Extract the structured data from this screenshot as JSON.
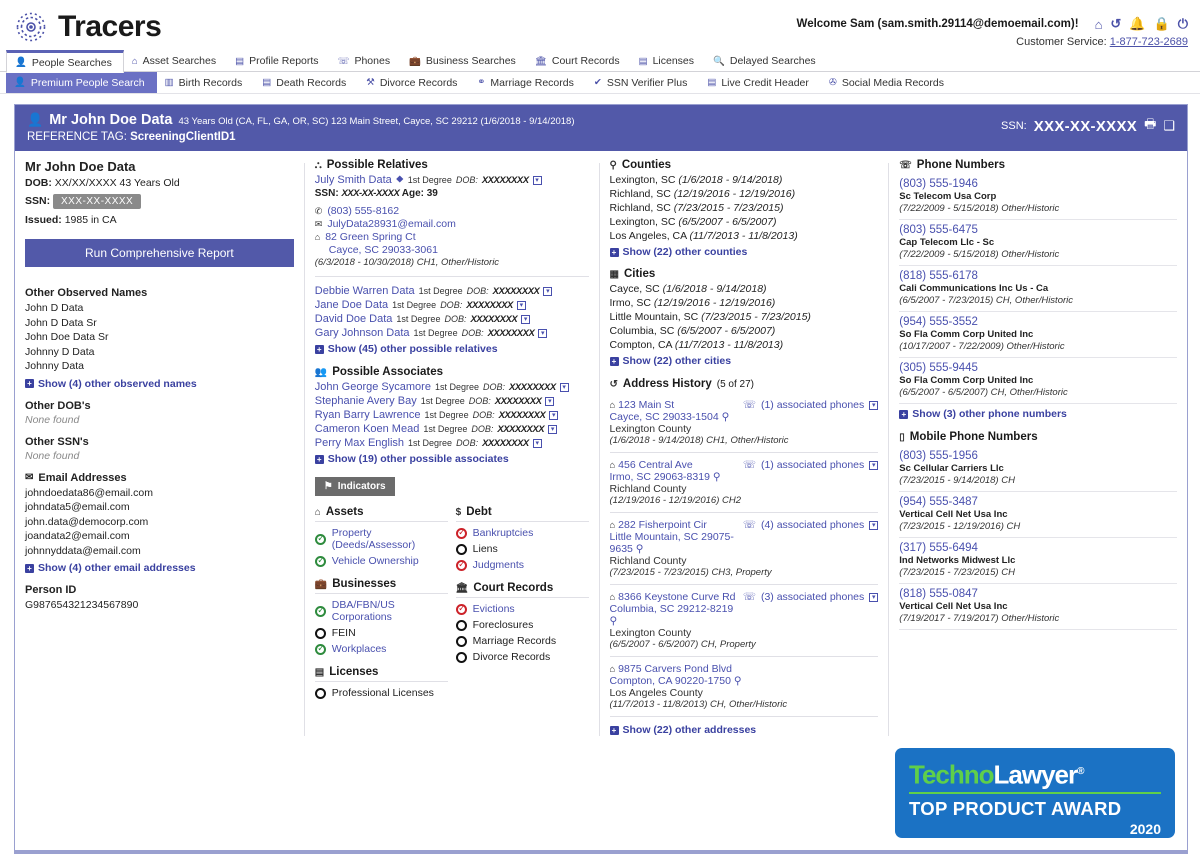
{
  "brand": {
    "name": "Tracers",
    "logo_icon": "radar-logo-icon"
  },
  "account": {
    "welcome": "Welcome Sam (sam.smith.29114@demoemail.com)!",
    "icons": [
      "home-icon",
      "history-icon",
      "bell-icon",
      "lock-icon",
      "power-icon"
    ],
    "customer_service_label": "Customer Service:",
    "customer_service_phone": "1-877-723-2689"
  },
  "nav_primary": [
    {
      "label": "People Searches",
      "icon": "person-icon",
      "active": true
    },
    {
      "label": "Asset Searches",
      "icon": "house-icon",
      "active": false
    },
    {
      "label": "Profile Reports",
      "icon": "document-icon",
      "active": false
    },
    {
      "label": "Phones",
      "icon": "phone-icon",
      "active": false
    },
    {
      "label": "Business Searches",
      "icon": "briefcase-icon",
      "active": false
    },
    {
      "label": "Court Records",
      "icon": "courthouse-icon",
      "active": false
    },
    {
      "label": "Licenses",
      "icon": "id-card-icon",
      "active": false
    },
    {
      "label": "Delayed Searches",
      "icon": "search-icon",
      "active": false
    }
  ],
  "nav_secondary": [
    {
      "label": "Premium People Search",
      "icon": "person-icon",
      "active": true
    },
    {
      "label": "Birth Records",
      "icon": "birth-icon",
      "active": false
    },
    {
      "label": "Death Records",
      "icon": "document-icon",
      "active": false
    },
    {
      "label": "Divorce Records",
      "icon": "broken-heart-icon",
      "active": false
    },
    {
      "label": "Marriage Records",
      "icon": "rings-icon",
      "active": false
    },
    {
      "label": "SSN Verifier Plus",
      "icon": "check-icon",
      "active": false
    },
    {
      "label": "Live Credit Header",
      "icon": "credit-card-icon",
      "active": false
    },
    {
      "label": "Social Media Records",
      "icon": "social-icon",
      "active": false
    }
  ],
  "banner": {
    "person_icon": "person-icon",
    "name": "Mr John Doe Data",
    "summary": "43 Years Old (CA, FL, GA, OR, SC) 123 Main Street, Cayce, SC 29212 (1/6/2018 - 9/14/2018)",
    "reference_tag_label": "REFERENCE TAG:",
    "reference_tag_value": "ScreeningClientID1",
    "ssn_label": "SSN:",
    "ssn_value": "XXX-XX-XXXX",
    "print_icon": "printer-icon",
    "save_icon": "save-icon",
    "bg_color": "#5259a9"
  },
  "identity": {
    "name": "Mr John Doe Data",
    "dob_label": "DOB:",
    "dob_value": "XX/XX/XXXX 43 Years Old",
    "ssn_label": "SSN:",
    "ssn_value": "XXX-XX-XXXX",
    "issued_label": "Issued:",
    "issued_value": "1985 in CA",
    "run_report_label": "Run Comprehensive Report"
  },
  "other_names": {
    "title": "Other Observed Names",
    "items": [
      "John D Data",
      "John D Data Sr",
      "John Doe Data Sr",
      "Johnny D Data",
      "Johnny Data"
    ],
    "show_more": "Show (4) other observed names"
  },
  "other_dobs": {
    "title": "Other DOB's",
    "empty": "None found"
  },
  "other_ssns": {
    "title": "Other SSN's",
    "empty": "None found"
  },
  "emails": {
    "title": "Email Addresses",
    "icon": "envelope-icon",
    "items": [
      "johndoedata86@email.com",
      "johndata5@email.com",
      "john.data@democorp.com",
      "joandata2@email.com",
      "johnnyddata@email.com"
    ],
    "show_more": "Show (4) other email addresses"
  },
  "person_id": {
    "title": "Person ID",
    "value": "G987654321234567890"
  },
  "relatives": {
    "title": "Possible Relatives",
    "icon": "sitemap-icon",
    "featured": {
      "name": "July Smith Data",
      "badge_icon": "diamond-icon",
      "degree": "1st Degree",
      "dob_label": "DOB:",
      "dob_value": "XXXXXXXX",
      "ssn_label": "SSN:",
      "ssn_value": "XXX-XX-XXXX",
      "age_label": "Age:",
      "age_value": "39",
      "phone": "(803) 555-8162",
      "email": "JulyData28931@email.com",
      "address_line1": "82 Green Spring Ct",
      "address_line2": "Cayce, SC 29033-3061",
      "meta": "(6/3/2018 - 10/30/2018) CH1, Other/Historic"
    },
    "others": [
      {
        "name": "Debbie Warren Data",
        "degree": "1st Degree",
        "dob_label": "DOB:",
        "dob_value": "XXXXXXXX"
      },
      {
        "name": "Jane Doe Data",
        "degree": "1st Degree",
        "dob_label": "DOB:",
        "dob_value": "XXXXXXXX"
      },
      {
        "name": "David Doe Data",
        "degree": "1st Degree",
        "dob_label": "DOB:",
        "dob_value": "XXXXXXXX"
      },
      {
        "name": "Gary Johnson Data",
        "degree": "1st Degree",
        "dob_label": "DOB:",
        "dob_value": "XXXXXXXX"
      }
    ],
    "show_more": "Show (45) other possible relatives"
  },
  "associates": {
    "title": "Possible Associates",
    "icon": "people-icon",
    "items": [
      {
        "name": "John George Sycamore",
        "degree": "1st Degree",
        "dob_label": "DOB:",
        "dob_value": "XXXXXXXX"
      },
      {
        "name": "Stephanie Avery Bay",
        "degree": "1st Degree",
        "dob_label": "DOB:",
        "dob_value": "XXXXXXXX"
      },
      {
        "name": "Ryan Barry Lawrence",
        "degree": "1st Degree",
        "dob_label": "DOB:",
        "dob_value": "XXXXXXXX"
      },
      {
        "name": "Cameron Koen Mead",
        "degree": "1st Degree",
        "dob_label": "DOB:",
        "dob_value": "XXXXXXXX"
      },
      {
        "name": "Perry Max English",
        "degree": "1st Degree",
        "dob_label": "DOB:",
        "dob_value": "XXXXXXXX"
      }
    ],
    "show_more": "Show (19) other possible associates"
  },
  "indicators_button": {
    "label": "Indicators",
    "icon": "flag-icon"
  },
  "assets": {
    "title": "Assets",
    "icon": "house-icon",
    "items": [
      {
        "label": "Property (Deeds/Assessor)",
        "state": "green"
      },
      {
        "label": "Vehicle Ownership",
        "state": "green"
      }
    ]
  },
  "businesses": {
    "title": "Businesses",
    "icon": "briefcase-icon",
    "items": [
      {
        "label": "DBA/FBN/US Corporations",
        "state": "green"
      },
      {
        "label": "FEIN",
        "state": "empty"
      },
      {
        "label": "Workplaces",
        "state": "green"
      }
    ]
  },
  "licenses": {
    "title": "Licenses",
    "icon": "id-card-icon",
    "items": [
      {
        "label": "Professional Licenses",
        "state": "empty"
      }
    ]
  },
  "debt": {
    "title": "Debt",
    "icon": "dollar-icon",
    "items": [
      {
        "label": "Bankruptcies",
        "state": "red"
      },
      {
        "label": "Liens",
        "state": "empty"
      },
      {
        "label": "Judgments",
        "state": "red"
      }
    ]
  },
  "court_records": {
    "title": "Court Records",
    "icon": "courthouse-icon",
    "items": [
      {
        "label": "Evictions",
        "state": "red"
      },
      {
        "label": "Foreclosures",
        "state": "empty"
      },
      {
        "label": "Marriage Records",
        "state": "empty"
      },
      {
        "label": "Divorce Records",
        "state": "empty"
      }
    ]
  },
  "counties": {
    "title": "Counties",
    "icon": "map-pin-icon",
    "items": [
      {
        "place": "Lexington, SC",
        "dates": "(1/6/2018 - 9/14/2018)"
      },
      {
        "place": "Richland, SC",
        "dates": "(12/19/2016 - 12/19/2016)"
      },
      {
        "place": "Richland, SC",
        "dates": "(7/23/2015 - 7/23/2015)"
      },
      {
        "place": "Lexington, SC",
        "dates": "(6/5/2007 - 6/5/2007)"
      },
      {
        "place": "Los Angeles, CA",
        "dates": "(11/7/2013 - 11/8/2013)"
      }
    ],
    "show_more": "Show (22) other counties"
  },
  "cities": {
    "title": "Cities",
    "icon": "city-icon",
    "items": [
      {
        "place": "Cayce, SC",
        "dates": "(1/6/2018 - 9/14/2018)"
      },
      {
        "place": "Irmo, SC",
        "dates": "(12/19/2016 - 12/19/2016)"
      },
      {
        "place": "Little Mountain, SC",
        "dates": "(7/23/2015 - 7/23/2015)"
      },
      {
        "place": "Columbia, SC",
        "dates": "(6/5/2007 - 6/5/2007)"
      },
      {
        "place": "Compton, CA",
        "dates": "(11/7/2013 - 11/8/2013)"
      }
    ],
    "show_more": "Show (22) other cities"
  },
  "address_history": {
    "title": "Address History",
    "count_label": "(5 of 27)",
    "icon": "history-icon",
    "items": [
      {
        "street": "123 Main St",
        "citystate": "Cayce, SC 29033-1504",
        "county": "Lexington County",
        "meta": "(1/6/2018 - 9/14/2018) CH1, Other/Historic",
        "phones_label": "(1) associated phones"
      },
      {
        "street": "456 Central Ave",
        "citystate": "Irmo, SC 29063-8319",
        "county": "Richland County",
        "meta": "(12/19/2016 - 12/19/2016) CH2",
        "phones_label": "(1) associated phones"
      },
      {
        "street": "282 Fisherpoint Cir",
        "citystate": "Little Mountain, SC 29075-9635",
        "county": "Richland County",
        "meta": "(7/23/2015 - 7/23/2015) CH3, Property",
        "phones_label": "(4) associated phones"
      },
      {
        "street": "8366 Keystone Curve Rd",
        "citystate": "Columbia, SC 29212-8219",
        "county": "Lexington County",
        "meta": "(6/5/2007 - 6/5/2007) CH, Property",
        "phones_label": "(3) associated phones"
      },
      {
        "street": "9875 Carvers Pond Blvd",
        "citystate": "Compton, CA 90220-1750",
        "county": "Los Angeles County",
        "meta": "(11/7/2013 - 11/8/2013) CH, Other/Historic",
        "phones_label": ""
      }
    ],
    "show_more": "Show (22) other addresses"
  },
  "phone_numbers": {
    "title": "Phone Numbers",
    "icon": "phone-icon",
    "items": [
      {
        "number": "(803) 555-1946",
        "carrier": "Sc Telecom Usa Corp",
        "meta": "(7/22/2009 - 5/15/2018) Other/Historic"
      },
      {
        "number": "(803) 555-6475",
        "carrier": "Cap Telecom Llc - Sc",
        "meta": "(7/22/2009 - 5/15/2018) Other/Historic"
      },
      {
        "number": "(818) 555-6178",
        "carrier": "Cali Communications Inc Us - Ca",
        "meta": "(6/5/2007 - 7/23/2015) CH, Other/Historic"
      },
      {
        "number": "(954) 555-3552",
        "carrier": "So Fla Comm Corp United Inc",
        "meta": "(10/17/2007 - 7/22/2009) Other/Historic"
      },
      {
        "number": "(305) 555-9445",
        "carrier": "So Fla Comm Corp United Inc",
        "meta": "(6/5/2007 - 6/5/2007) CH, Other/Historic"
      }
    ],
    "show_more": "Show (3) other phone numbers"
  },
  "mobile_phone_numbers": {
    "title": "Mobile Phone Numbers",
    "icon": "mobile-icon",
    "items": [
      {
        "number": "(803) 555-1956",
        "carrier": "Sc Cellular Carriers Llc",
        "meta": "(7/23/2015 - 9/14/2018) CH"
      },
      {
        "number": "(954) 555-3487",
        "carrier": "Vertical Cell Net Usa Inc",
        "meta": "(7/23/2015 - 12/19/2016) CH"
      },
      {
        "number": "(317) 555-6494",
        "carrier": "Ind Networks Midwest Llc",
        "meta": "(7/23/2015 - 7/23/2015) CH"
      },
      {
        "number": "(818) 555-0847",
        "carrier": "Vertical Cell Net Usa Inc",
        "meta": "(7/19/2017 - 7/19/2017) Other/Historic"
      }
    ]
  },
  "award": {
    "brand_techno": "Techno",
    "brand_lawyer": "Lawyer",
    "registered": "®",
    "line2": "TOP PRODUCT AWARD",
    "year": "2020",
    "bg_color": "#1b72c4",
    "accent_color": "#5fcf4a"
  }
}
